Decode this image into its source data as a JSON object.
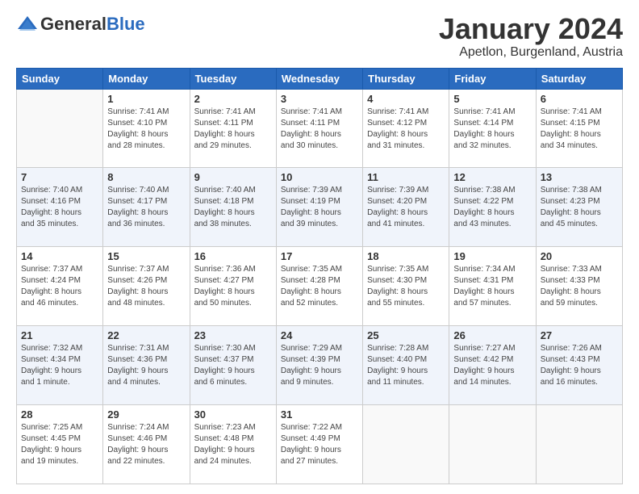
{
  "header": {
    "logo_general": "General",
    "logo_blue": "Blue",
    "month_title": "January 2024",
    "subtitle": "Apetlon, Burgenland, Austria"
  },
  "days_of_week": [
    "Sunday",
    "Monday",
    "Tuesday",
    "Wednesday",
    "Thursday",
    "Friday",
    "Saturday"
  ],
  "weeks": [
    [
      {
        "day": "",
        "info": ""
      },
      {
        "day": "1",
        "info": "Sunrise: 7:41 AM\nSunset: 4:10 PM\nDaylight: 8 hours\nand 28 minutes."
      },
      {
        "day": "2",
        "info": "Sunrise: 7:41 AM\nSunset: 4:11 PM\nDaylight: 8 hours\nand 29 minutes."
      },
      {
        "day": "3",
        "info": "Sunrise: 7:41 AM\nSunset: 4:11 PM\nDaylight: 8 hours\nand 30 minutes."
      },
      {
        "day": "4",
        "info": "Sunrise: 7:41 AM\nSunset: 4:12 PM\nDaylight: 8 hours\nand 31 minutes."
      },
      {
        "day": "5",
        "info": "Sunrise: 7:41 AM\nSunset: 4:14 PM\nDaylight: 8 hours\nand 32 minutes."
      },
      {
        "day": "6",
        "info": "Sunrise: 7:41 AM\nSunset: 4:15 PM\nDaylight: 8 hours\nand 34 minutes."
      }
    ],
    [
      {
        "day": "7",
        "info": "Sunrise: 7:40 AM\nSunset: 4:16 PM\nDaylight: 8 hours\nand 35 minutes."
      },
      {
        "day": "8",
        "info": "Sunrise: 7:40 AM\nSunset: 4:17 PM\nDaylight: 8 hours\nand 36 minutes."
      },
      {
        "day": "9",
        "info": "Sunrise: 7:40 AM\nSunset: 4:18 PM\nDaylight: 8 hours\nand 38 minutes."
      },
      {
        "day": "10",
        "info": "Sunrise: 7:39 AM\nSunset: 4:19 PM\nDaylight: 8 hours\nand 39 minutes."
      },
      {
        "day": "11",
        "info": "Sunrise: 7:39 AM\nSunset: 4:20 PM\nDaylight: 8 hours\nand 41 minutes."
      },
      {
        "day": "12",
        "info": "Sunrise: 7:38 AM\nSunset: 4:22 PM\nDaylight: 8 hours\nand 43 minutes."
      },
      {
        "day": "13",
        "info": "Sunrise: 7:38 AM\nSunset: 4:23 PM\nDaylight: 8 hours\nand 45 minutes."
      }
    ],
    [
      {
        "day": "14",
        "info": "Sunrise: 7:37 AM\nSunset: 4:24 PM\nDaylight: 8 hours\nand 46 minutes."
      },
      {
        "day": "15",
        "info": "Sunrise: 7:37 AM\nSunset: 4:26 PM\nDaylight: 8 hours\nand 48 minutes."
      },
      {
        "day": "16",
        "info": "Sunrise: 7:36 AM\nSunset: 4:27 PM\nDaylight: 8 hours\nand 50 minutes."
      },
      {
        "day": "17",
        "info": "Sunrise: 7:35 AM\nSunset: 4:28 PM\nDaylight: 8 hours\nand 52 minutes."
      },
      {
        "day": "18",
        "info": "Sunrise: 7:35 AM\nSunset: 4:30 PM\nDaylight: 8 hours\nand 55 minutes."
      },
      {
        "day": "19",
        "info": "Sunrise: 7:34 AM\nSunset: 4:31 PM\nDaylight: 8 hours\nand 57 minutes."
      },
      {
        "day": "20",
        "info": "Sunrise: 7:33 AM\nSunset: 4:33 PM\nDaylight: 8 hours\nand 59 minutes."
      }
    ],
    [
      {
        "day": "21",
        "info": "Sunrise: 7:32 AM\nSunset: 4:34 PM\nDaylight: 9 hours\nand 1 minute."
      },
      {
        "day": "22",
        "info": "Sunrise: 7:31 AM\nSunset: 4:36 PM\nDaylight: 9 hours\nand 4 minutes."
      },
      {
        "day": "23",
        "info": "Sunrise: 7:30 AM\nSunset: 4:37 PM\nDaylight: 9 hours\nand 6 minutes."
      },
      {
        "day": "24",
        "info": "Sunrise: 7:29 AM\nSunset: 4:39 PM\nDaylight: 9 hours\nand 9 minutes."
      },
      {
        "day": "25",
        "info": "Sunrise: 7:28 AM\nSunset: 4:40 PM\nDaylight: 9 hours\nand 11 minutes."
      },
      {
        "day": "26",
        "info": "Sunrise: 7:27 AM\nSunset: 4:42 PM\nDaylight: 9 hours\nand 14 minutes."
      },
      {
        "day": "27",
        "info": "Sunrise: 7:26 AM\nSunset: 4:43 PM\nDaylight: 9 hours\nand 16 minutes."
      }
    ],
    [
      {
        "day": "28",
        "info": "Sunrise: 7:25 AM\nSunset: 4:45 PM\nDaylight: 9 hours\nand 19 minutes."
      },
      {
        "day": "29",
        "info": "Sunrise: 7:24 AM\nSunset: 4:46 PM\nDaylight: 9 hours\nand 22 minutes."
      },
      {
        "day": "30",
        "info": "Sunrise: 7:23 AM\nSunset: 4:48 PM\nDaylight: 9 hours\nand 24 minutes."
      },
      {
        "day": "31",
        "info": "Sunrise: 7:22 AM\nSunset: 4:49 PM\nDaylight: 9 hours\nand 27 minutes."
      },
      {
        "day": "",
        "info": ""
      },
      {
        "day": "",
        "info": ""
      },
      {
        "day": "",
        "info": ""
      }
    ]
  ]
}
